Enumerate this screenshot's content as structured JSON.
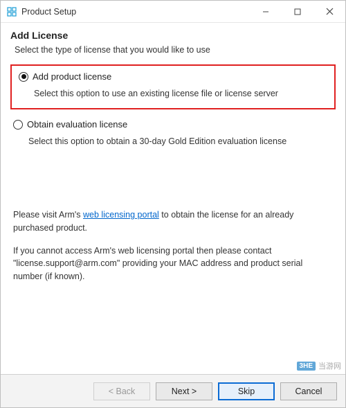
{
  "window": {
    "title": "Product Setup"
  },
  "header": {
    "heading": "Add License",
    "sub": "Select the type of license that you would like to use"
  },
  "options": {
    "add": {
      "label": "Add product license",
      "desc": "Select this option to use an existing license file or license server",
      "selected": true
    },
    "eval": {
      "label": "Obtain evaluation license",
      "desc": "Select this option to obtain a 30-day Gold Edition evaluation license",
      "selected": false
    }
  },
  "info": {
    "p1_pre": "Please visit Arm's ",
    "p1_link": "web licensing portal",
    "p1_post": " to obtain the license for an already purchased product.",
    "p2": "If you cannot access Arm's web licensing portal then please contact \"license.support@arm.com\" providing your MAC address and product serial number (if known)."
  },
  "buttons": {
    "back": "< Back",
    "next": "Next >",
    "skip": "Skip",
    "cancel": "Cancel"
  },
  "watermark": {
    "badge": "3HE",
    "text": "当游网"
  }
}
